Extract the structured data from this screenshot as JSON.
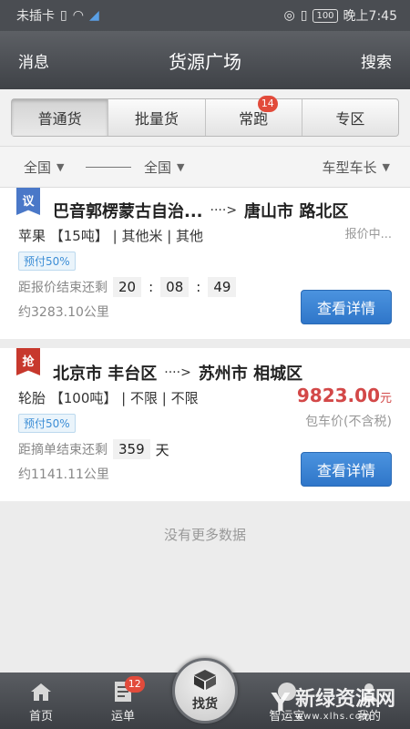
{
  "status_bar": {
    "carrier": "未插卡",
    "battery": "100",
    "time": "晚上7:45"
  },
  "nav": {
    "left": "消息",
    "title": "货源广场",
    "right": "搜索"
  },
  "segments": [
    {
      "label": "普通货",
      "active": true
    },
    {
      "label": "批量货"
    },
    {
      "label": "常跑",
      "badge": "14"
    },
    {
      "label": "专区"
    }
  ],
  "filters": {
    "origin": "全国",
    "destination": "全国",
    "vehicle": "车型车长"
  },
  "cards": [
    {
      "tag": "议",
      "tag_color": "#4a78c8",
      "origin": "巴音郭楞蒙古自治...",
      "arrow": "····>",
      "destination": "唐山市 路北区",
      "goods": "苹果 【15吨】 | 其他米 | 其他",
      "price_note": "报价中...",
      "pay": "预付50%",
      "countdown_label": "距报价结束还剩",
      "countdown": [
        "20",
        "08",
        "49"
      ],
      "distance": "约3283.10公里",
      "button": "查看详情"
    },
    {
      "tag": "抢",
      "tag_color": "#c7382d",
      "origin": "北京市 丰台区",
      "arrow": "····>",
      "destination": "苏州市 相城区",
      "goods": "轮胎 【100吨】 | 不限 | 不限",
      "price": "9823.00",
      "price_unit": "元",
      "price_sub": "包车价(不含税)",
      "pay": "预付50%",
      "countdown_label": "距摘单结束还剩",
      "countdown_days": "359",
      "countdown_unit": "天",
      "distance": "约1141.11公里",
      "button": "查看详情"
    }
  ],
  "footer_text": "没有更多数据",
  "tabbar": {
    "home": "首页",
    "orders": "运单",
    "orders_badge": "12",
    "find": "找货",
    "smart": "智运宝",
    "mine": "我的"
  },
  "watermark": {
    "main": "新绿资源网",
    "sub": "www.xlhs.com"
  }
}
